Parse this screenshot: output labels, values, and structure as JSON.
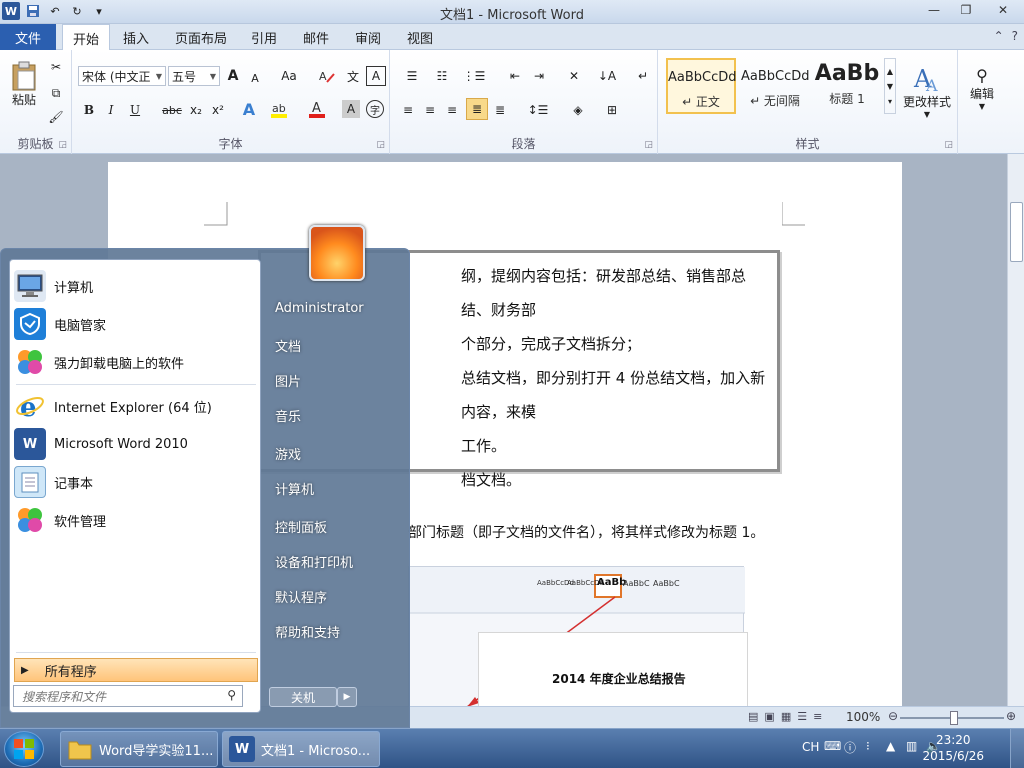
{
  "window": {
    "title": "文档1 - Microsoft Word",
    "min": "—",
    "max": "❐",
    "close": "✕"
  },
  "tabs": {
    "file": "文件",
    "items": [
      "开始",
      "插入",
      "页面布局",
      "引用",
      "邮件",
      "审阅",
      "视图"
    ]
  },
  "ribbon": {
    "clipboard": {
      "label": "剪贴板",
      "paste": "粘贴"
    },
    "font": {
      "label": "字体",
      "font_name": "宋体 (中文正",
      "font_size": "五号",
      "grow": "A",
      "shrink": "A",
      "case": "Aa",
      "bold": "B",
      "italic": "I",
      "underline": "U",
      "strike": "abc",
      "sub": "x₂",
      "sup": "x²"
    },
    "paragraph": {
      "label": "段落"
    },
    "styles": {
      "label": "样式",
      "items": [
        {
          "sample": "AaBbCcDd",
          "name": "↵ 正文"
        },
        {
          "sample": "AaBbCcDd",
          "name": "↵ 无间隔"
        },
        {
          "sample": "AaBb",
          "name": "标题 1"
        }
      ],
      "change": "更改样式"
    },
    "edit": {
      "label": "编辑"
    }
  },
  "document": {
    "textbox_lines": [
      "纲，提纲内容包括：研发部总结、销售部总结、财务部",
      "个部分，完成子文档拆分；",
      "总结文档，即分别打开 4 份总结文档，加入新内容，来模",
      "工作。",
      "档文档。"
    ],
    "line_below": "部门标题（即子文档的文件名），将其样式修改为标题 1。",
    "shot_title": "2014 年度企业总结报告",
    "shot_style_1": "AaBbCcDd",
    "shot_style_2": "AaBbCcDd",
    "shot_style_3": "AaBb",
    "shot_style_4": "AaBbC",
    "shot_style_5": "AaBbC"
  },
  "statusbar": {
    "zoom": "100%"
  },
  "startmenu": {
    "left_items": [
      "计算机",
      "电脑管家",
      "强力卸载电脑上的软件",
      "Internet Explorer (64 位)",
      "Microsoft Word 2010",
      "记事本",
      "软件管理"
    ],
    "all_programs": "所有程序",
    "search_placeholder": "搜索程序和文件",
    "right_items": [
      "Administrator",
      "文档",
      "图片",
      "音乐",
      "游戏",
      "计算机",
      "控制面板",
      "设备和打印机",
      "默认程序",
      "帮助和支持"
    ],
    "shutdown": "关机"
  },
  "taskbar": {
    "tasks": [
      "Word导学实验11...",
      "文档1 - Microso..."
    ],
    "ime": "CH",
    "time": "23:20",
    "date": "2015/6/26"
  }
}
